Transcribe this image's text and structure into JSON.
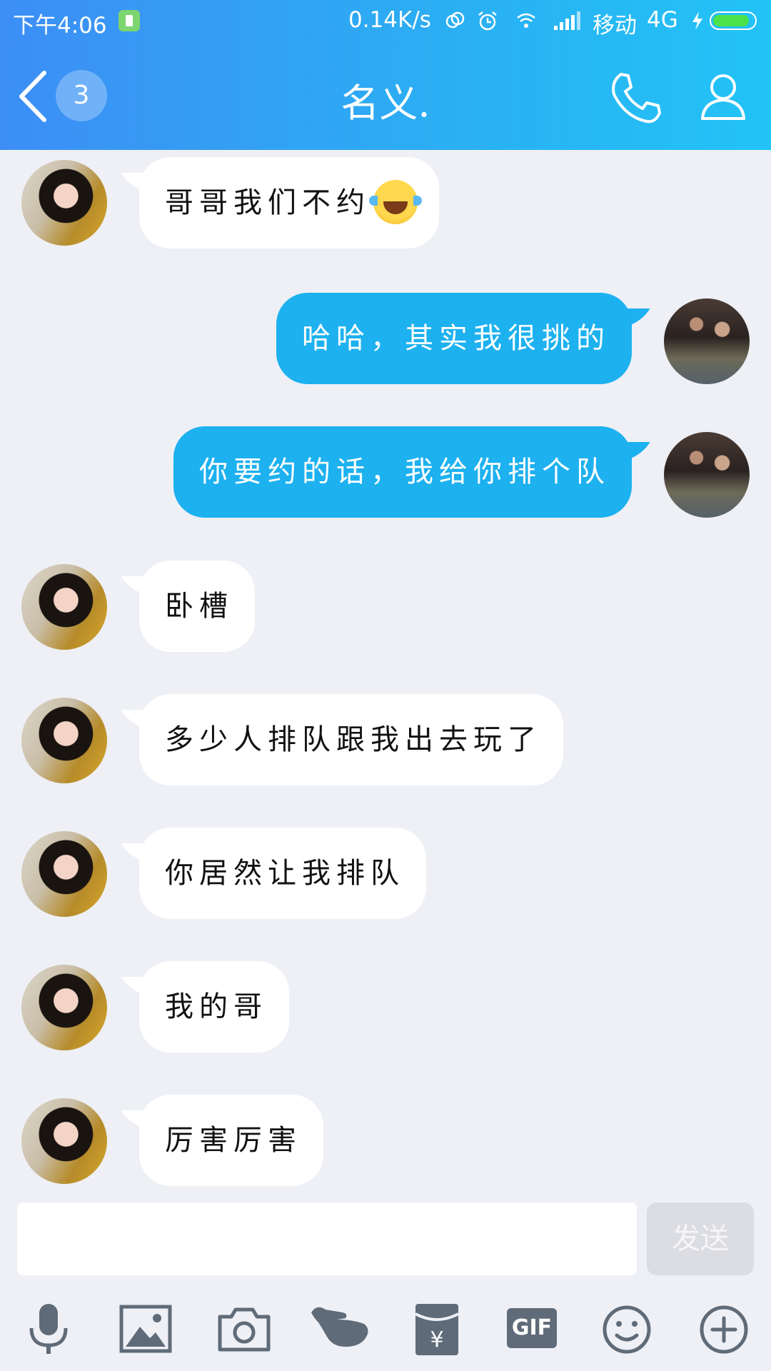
{
  "status_bar": {
    "time": "下午4:06",
    "speed": "0.14K/s",
    "carrier": "移动",
    "network": "4G",
    "battery_level": 0.9,
    "battery_color": "#4be14b"
  },
  "header": {
    "unread_count": "3",
    "title": "名义.",
    "gradient_colors": [
      "#3d8ef5",
      "#22c3f6"
    ]
  },
  "messages": [
    {
      "sender": "them",
      "text": "哥哥我们不约",
      "emoji": "joy-tears-emoji"
    },
    {
      "sender": "me",
      "text": "哈哈，其实我很挑的"
    },
    {
      "sender": "me",
      "text": "你要约的话，我给你排个队"
    },
    {
      "sender": "them",
      "text": "卧槽"
    },
    {
      "sender": "them",
      "text": "多少人排队跟我出去玩了"
    },
    {
      "sender": "them",
      "text": "你居然让我排队"
    },
    {
      "sender": "them",
      "text": "我的哥"
    },
    {
      "sender": "them",
      "text": "厉害厉害"
    }
  ],
  "input": {
    "value": "",
    "placeholder": "",
    "send_label": "发送"
  },
  "toolbar": {
    "items": [
      {
        "icon": "microphone-icon"
      },
      {
        "icon": "image-icon"
      },
      {
        "icon": "camera-icon"
      },
      {
        "icon": "poke-hand-icon"
      },
      {
        "icon": "red-envelope-icon",
        "label": "¥"
      },
      {
        "icon": "gif-icon",
        "label": "GIF"
      },
      {
        "icon": "smiley-icon"
      },
      {
        "icon": "plus-icon"
      }
    ]
  },
  "colors": {
    "my_bubble": "#1db1f0",
    "their_bubble": "#ffffff",
    "chat_background": "#eef0f6"
  }
}
